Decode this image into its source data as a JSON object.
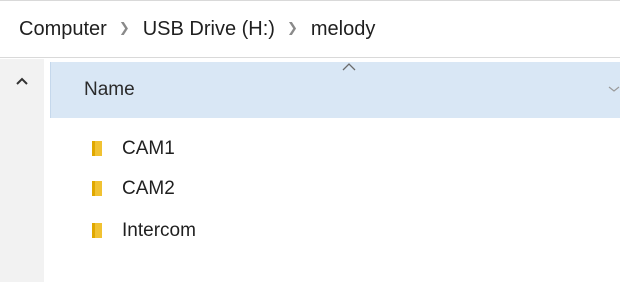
{
  "breadcrumb": {
    "items": [
      "Computer",
      "USB Drive (H:)",
      "melody"
    ],
    "separator": ">"
  },
  "column_header": {
    "name_label": "Name"
  },
  "files": [
    {
      "name": "CAM1",
      "icon": "folder-icon"
    },
    {
      "name": "CAM2",
      "icon": "folder-icon"
    },
    {
      "name": "Intercom",
      "icon": "folder-icon"
    }
  ],
  "colors": {
    "header_bg": "#d9e7f5",
    "folder": "#f1c232",
    "nav_bg": "#f2f2f2"
  }
}
